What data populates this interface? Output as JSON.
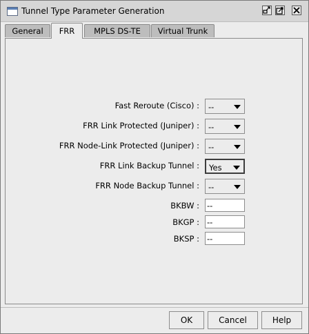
{
  "window": {
    "title": "Tunnel Type Parameter Generation"
  },
  "tabs": [
    {
      "label": "General",
      "active": false
    },
    {
      "label": "FRR",
      "active": true
    },
    {
      "label": "MPLS DS-TE",
      "active": false
    },
    {
      "label": "Virtual Trunk",
      "active": false
    }
  ],
  "form": {
    "fields": [
      {
        "label": "Fast Reroute (Cisco) :",
        "value": "--",
        "type": "dropdown"
      },
      {
        "label": "FRR Link Protected (Juniper) :",
        "value": "--",
        "type": "dropdown"
      },
      {
        "label": "FRR Node-Link Protected (Juniper) :",
        "value": "--",
        "type": "dropdown"
      },
      {
        "label": "FRR Link Backup Tunnel :",
        "value": "Yes",
        "type": "dropdown",
        "focused": true
      },
      {
        "label": "FRR Node Backup Tunnel :",
        "value": "--",
        "type": "dropdown"
      },
      {
        "label": "BKBW :",
        "value": "--",
        "type": "text"
      },
      {
        "label": "BKGP :",
        "value": "--",
        "type": "text"
      },
      {
        "label": "BKSP :",
        "value": "--",
        "type": "text"
      }
    ]
  },
  "buttons": {
    "ok": "OK",
    "cancel": "Cancel",
    "help": "Help"
  },
  "icons": {
    "app": "window-icon",
    "minimize": "iconify-icon",
    "maximize": "maximize-icon",
    "close": "close-icon"
  }
}
